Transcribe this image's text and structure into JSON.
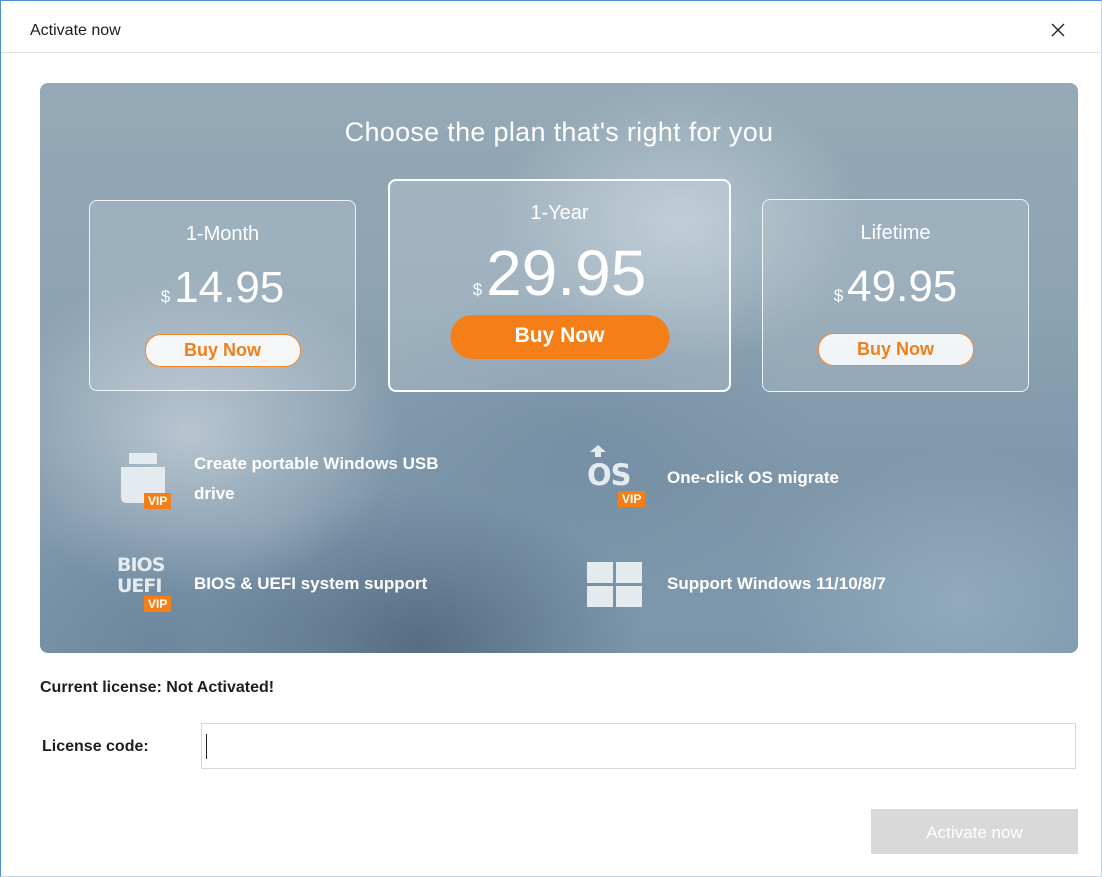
{
  "window": {
    "title": "Activate now"
  },
  "banner": {
    "title": "Choose the plan that's right for you",
    "plans": [
      {
        "name": "1-Month",
        "currency": "$",
        "price": "14.95",
        "buy_label": "Buy Now"
      },
      {
        "name": "1-Year",
        "currency": "$",
        "price": "29.95",
        "buy_label": "Buy Now"
      },
      {
        "name": "Lifetime",
        "currency": "$",
        "price": "49.95",
        "buy_label": "Buy Now"
      }
    ],
    "features": [
      {
        "label_line1": "Create portable Windows USB",
        "label_line2": "drive",
        "icon": "usb-drive-icon",
        "badge": "VIP"
      },
      {
        "label": "One-click OS migrate",
        "icon": "os-migrate-icon",
        "icon_text": "OS",
        "badge": "VIP"
      },
      {
        "label": "BIOS & UEFI system support",
        "icon": "bios-uefi-icon",
        "icon_text_1": "BIOS",
        "icon_text_2": "UEFI",
        "badge": "VIP"
      },
      {
        "label": "Support Windows 11/10/8/7",
        "icon": "windows-logo-icon"
      }
    ]
  },
  "license": {
    "status_text": "Current license: Not Activated!",
    "code_label": "License code:",
    "code_value": "",
    "activate_label": "Activate now"
  },
  "colors": {
    "accent_orange": "#f47f18",
    "disabled_button": "#d9d9d9",
    "window_border": "#4a8fd8"
  }
}
